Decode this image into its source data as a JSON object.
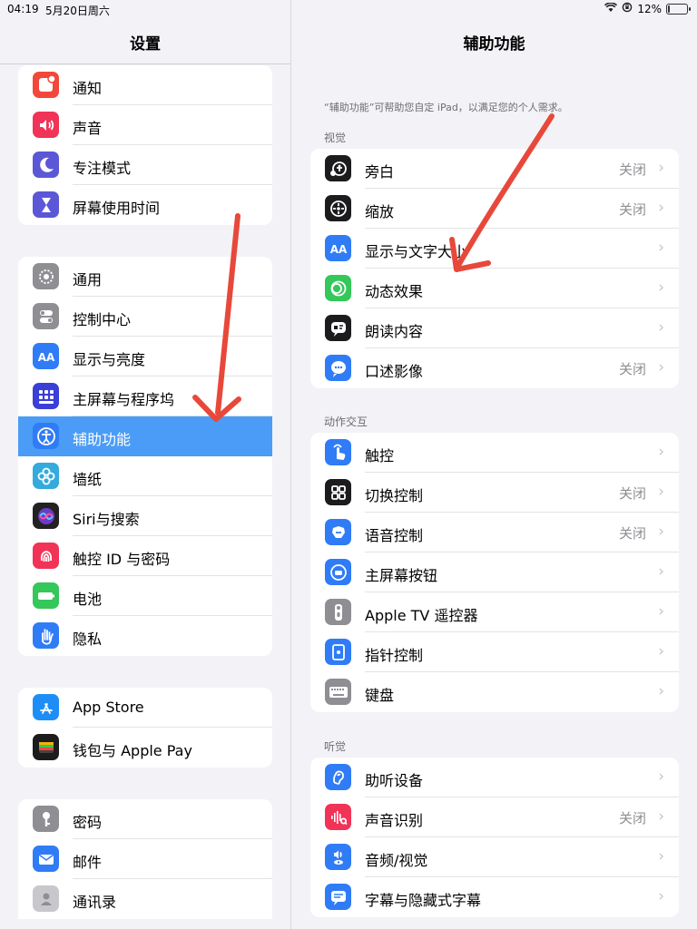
{
  "status_bar": {
    "time": "04:19",
    "date": "5月20日周六",
    "battery": "12%",
    "battery_level": 0.12
  },
  "sidebar": {
    "title": "设置",
    "groups": [
      [
        {
          "label": "通知",
          "icon": "notifications-icon",
          "color": "#f2473a"
        },
        {
          "label": "声音",
          "icon": "sound-icon",
          "color": "#f03357"
        },
        {
          "label": "专注模式",
          "icon": "focus-moon-icon",
          "color": "#5b57d6"
        },
        {
          "label": "屏幕使用时间",
          "icon": "hourglass-icon",
          "color": "#5b57d6"
        }
      ],
      [
        {
          "label": "通用",
          "icon": "gear-icon",
          "color": "#8e8e93"
        },
        {
          "label": "控制中心",
          "icon": "toggles-icon",
          "color": "#8e8e93"
        },
        {
          "label": "显示与亮度",
          "icon": "display-aa-icon",
          "color": "#2f7cf6"
        },
        {
          "label": "主屏幕与程序坞",
          "icon": "home-grid-icon",
          "color": "#3a3fd6"
        },
        {
          "label": "辅助功能",
          "icon": "accessibility-icon",
          "color": "#2f7cf6"
        },
        {
          "label": "墙纸",
          "icon": "wallpaper-flower-icon",
          "color": "#35aadc"
        },
        {
          "label": "Siri与搜索",
          "icon": "siri-icon",
          "color": "#222222"
        },
        {
          "label": "触控 ID 与密码",
          "icon": "fingerprint-icon",
          "color": "#f03357"
        },
        {
          "label": "电池",
          "icon": "battery-icon",
          "color": "#34c759"
        },
        {
          "label": "隐私",
          "icon": "hand-icon",
          "color": "#2f7cf6"
        }
      ],
      [
        {
          "label": "App Store",
          "icon": "app-store-icon",
          "color": "#1e8ef6"
        },
        {
          "label": "钱包与 Apple Pay",
          "icon": "wallet-icon",
          "color": "#1c1c1e"
        }
      ],
      [
        {
          "label": "密码",
          "icon": "key-icon",
          "color": "#8e8e93"
        },
        {
          "label": "邮件",
          "icon": "mail-icon",
          "color": "#2f7cf6"
        },
        {
          "label": "通讯录",
          "icon": "contacts-icon",
          "color": "#c7c7cc"
        }
      ]
    ],
    "selected_label": "辅助功能"
  },
  "main": {
    "title": "辅助功能",
    "description": "“辅助功能”可帮助您自定 iPad，以满足您的个人需求。",
    "sections": [
      {
        "header": "视觉",
        "items": [
          {
            "label": "旁白",
            "value": "关闭",
            "icon": "voiceover-icon",
            "color": "#1c1c1e"
          },
          {
            "label": "缩放",
            "value": "关闭",
            "icon": "zoom-icon",
            "color": "#1c1c1e"
          },
          {
            "label": "显示与文字大小",
            "value": "",
            "icon": "text-size-aa-icon",
            "color": "#2f7cf6"
          },
          {
            "label": "动态效果",
            "value": "",
            "icon": "motion-icon",
            "color": "#34c759"
          },
          {
            "label": "朗读内容",
            "value": "",
            "icon": "spoken-content-icon",
            "color": "#1c1c1e"
          },
          {
            "label": "口述影像",
            "value": "关闭",
            "icon": "audio-description-icon",
            "color": "#2f7cf6"
          }
        ]
      },
      {
        "header": "动作交互",
        "items": [
          {
            "label": "触控",
            "value": "",
            "icon": "touch-hand-icon",
            "color": "#2f7cf6"
          },
          {
            "label": "切换控制",
            "value": "关闭",
            "icon": "switch-control-icon",
            "color": "#1c1c1e"
          },
          {
            "label": "语音控制",
            "value": "关闭",
            "icon": "voice-control-icon",
            "color": "#2f7cf6"
          },
          {
            "label": "主屏幕按钮",
            "value": "",
            "icon": "home-button-icon",
            "color": "#2f7cf6"
          },
          {
            "label": "Apple TV 遥控器",
            "value": "",
            "icon": "remote-icon",
            "color": "#8e8e93"
          },
          {
            "label": "指针控制",
            "value": "",
            "icon": "pointer-control-icon",
            "color": "#2f7cf6"
          },
          {
            "label": "键盘",
            "value": "",
            "icon": "keyboard-icon",
            "color": "#8e8e93"
          }
        ]
      },
      {
        "header": "听觉",
        "items": [
          {
            "label": "助听设备",
            "value": "",
            "icon": "ear-icon",
            "color": "#2f7cf6"
          },
          {
            "label": "声音识别",
            "value": "关闭",
            "icon": "sound-recognition-icon",
            "color": "#f03357"
          },
          {
            "label": "音频/视觉",
            "value": "",
            "icon": "audio-visual-icon",
            "color": "#2f7cf6"
          },
          {
            "label": "字幕与隐藏式字幕",
            "value": "",
            "icon": "captions-icon",
            "color": "#2f7cf6"
          }
        ]
      }
    ]
  },
  "annotation_color": "#e8483a"
}
